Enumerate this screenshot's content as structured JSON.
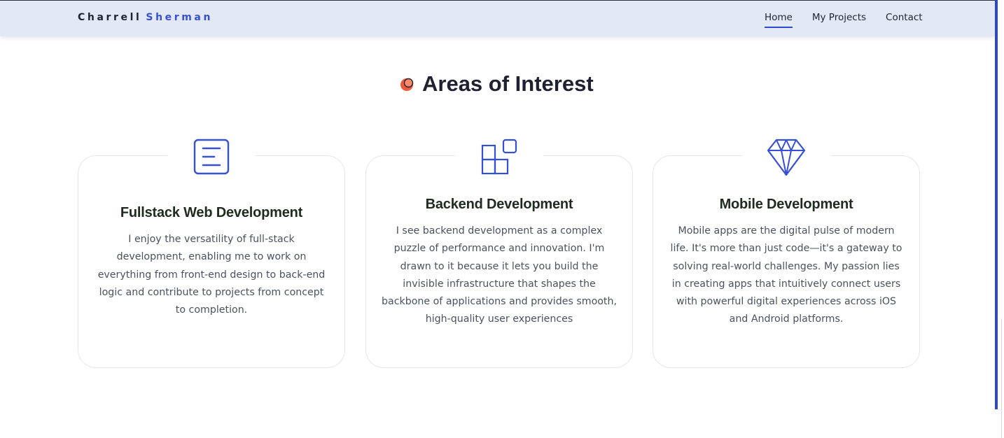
{
  "header": {
    "brand_first": "Charrell",
    "brand_last": "Sherman",
    "nav": [
      {
        "label": "Home",
        "active": true
      },
      {
        "label": "My Projects",
        "active": false
      },
      {
        "label": "Contact",
        "active": false
      }
    ]
  },
  "section": {
    "title": "Areas of Interest",
    "title_icon": "orange-circle-icon"
  },
  "cards": [
    {
      "icon": "document-lines-icon",
      "title": "Fullstack Web Development",
      "text": "I enjoy the versatility of full-stack development, enabling me to work on everything from front-end design to back-end logic and contribute to projects from concept to completion."
    },
    {
      "icon": "blocks-icon",
      "title": "Backend Development",
      "text": "I see backend development as a complex puzzle of performance and innovation. I'm drawn to it because it lets you build the invisible infrastructure that shapes the backbone of applications and provides smooth, high-quality user experiences"
    },
    {
      "icon": "diamond-icon",
      "title": "Mobile Development",
      "text": "Mobile apps are the digital pulse of modern life. It's more than just code—it's a gateway to solving real-world challenges. My passion lies in creating apps that intuitively connect users with powerful digital experiences across iOS and Android platforms."
    }
  ],
  "colors": {
    "accent": "#3550d6",
    "navbar_bg": "#e2e8f6",
    "title_dot": "#f05a3c"
  }
}
